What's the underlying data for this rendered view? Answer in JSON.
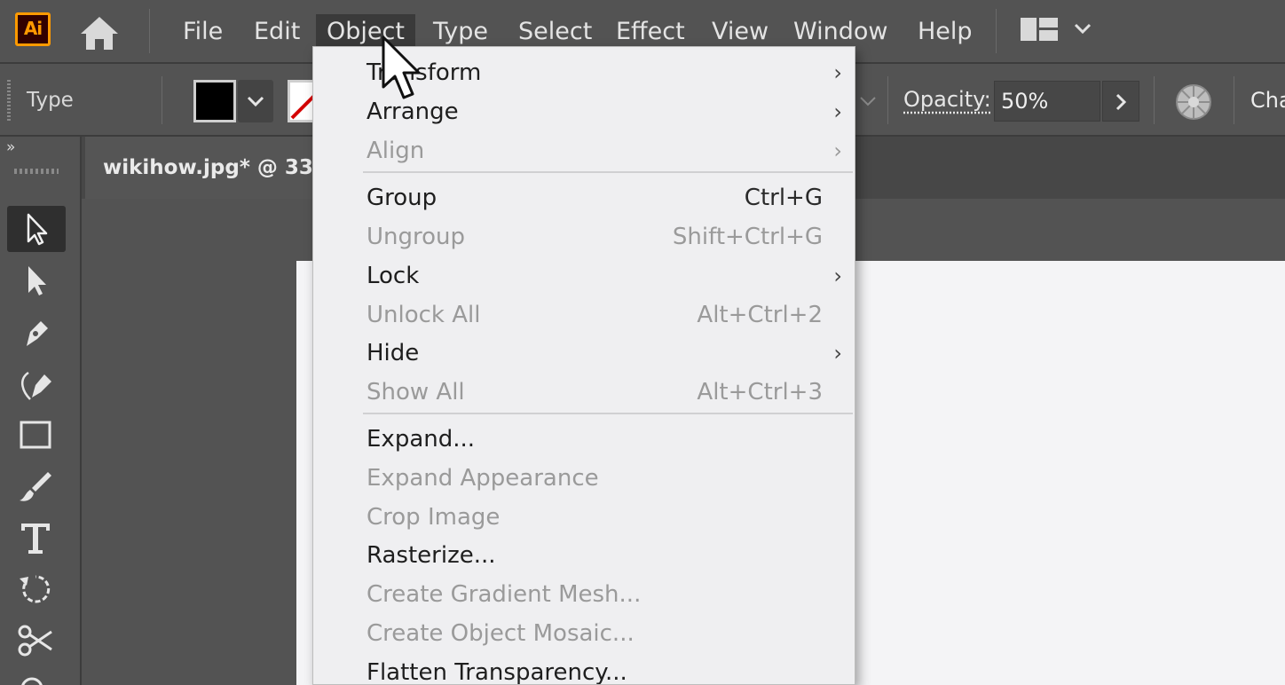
{
  "app": {
    "logo_text": "Ai",
    "accent": "#ff9a00"
  },
  "menubar": {
    "items": [
      "File",
      "Edit",
      "Object",
      "Type",
      "Select",
      "Effect",
      "View",
      "Window",
      "Help"
    ],
    "active": "Object"
  },
  "control_bar": {
    "label": "Type",
    "fill_color": "#000000",
    "opacity_label": "Opacity:",
    "opacity_value": "50%",
    "right_label": "Cha"
  },
  "document": {
    "tab_title": "wikihow.jpg* @ 33."
  },
  "tools": [
    "selection-tool",
    "direct-selection-tool",
    "pen-tool",
    "curvature-tool",
    "rectangle-tool",
    "paintbrush-tool",
    "type-tool",
    "rotate-tool",
    "scissors-tool",
    "zoom-tool"
  ],
  "object_menu": {
    "items": [
      {
        "label": "Transform",
        "shortcut": "",
        "submenu": true,
        "disabled": false
      },
      {
        "label": "Arrange",
        "shortcut": "",
        "submenu": true,
        "disabled": false
      },
      {
        "label": "Align",
        "shortcut": "",
        "submenu": true,
        "disabled": true
      },
      {
        "label": "Group",
        "shortcut": "Ctrl+G",
        "submenu": false,
        "disabled": false
      },
      {
        "label": "Ungroup",
        "shortcut": "Shift+Ctrl+G",
        "submenu": false,
        "disabled": true
      },
      {
        "label": "Lock",
        "shortcut": "",
        "submenu": true,
        "disabled": false
      },
      {
        "label": "Unlock All",
        "shortcut": "Alt+Ctrl+2",
        "submenu": false,
        "disabled": true
      },
      {
        "label": "Hide",
        "shortcut": "",
        "submenu": true,
        "disabled": false
      },
      {
        "label": "Show All",
        "shortcut": "Alt+Ctrl+3",
        "submenu": false,
        "disabled": true
      },
      {
        "label": "Expand...",
        "shortcut": "",
        "submenu": false,
        "disabled": false
      },
      {
        "label": "Expand Appearance",
        "shortcut": "",
        "submenu": false,
        "disabled": true
      },
      {
        "label": "Crop Image",
        "shortcut": "",
        "submenu": false,
        "disabled": true
      },
      {
        "label": "Rasterize...",
        "shortcut": "",
        "submenu": false,
        "disabled": false
      },
      {
        "label": "Create Gradient Mesh...",
        "shortcut": "",
        "submenu": false,
        "disabled": true
      },
      {
        "label": "Create Object Mosaic...",
        "shortcut": "",
        "submenu": false,
        "disabled": true
      },
      {
        "label": "Flatten Transparency...",
        "shortcut": "",
        "submenu": false,
        "disabled": false
      }
    ]
  }
}
